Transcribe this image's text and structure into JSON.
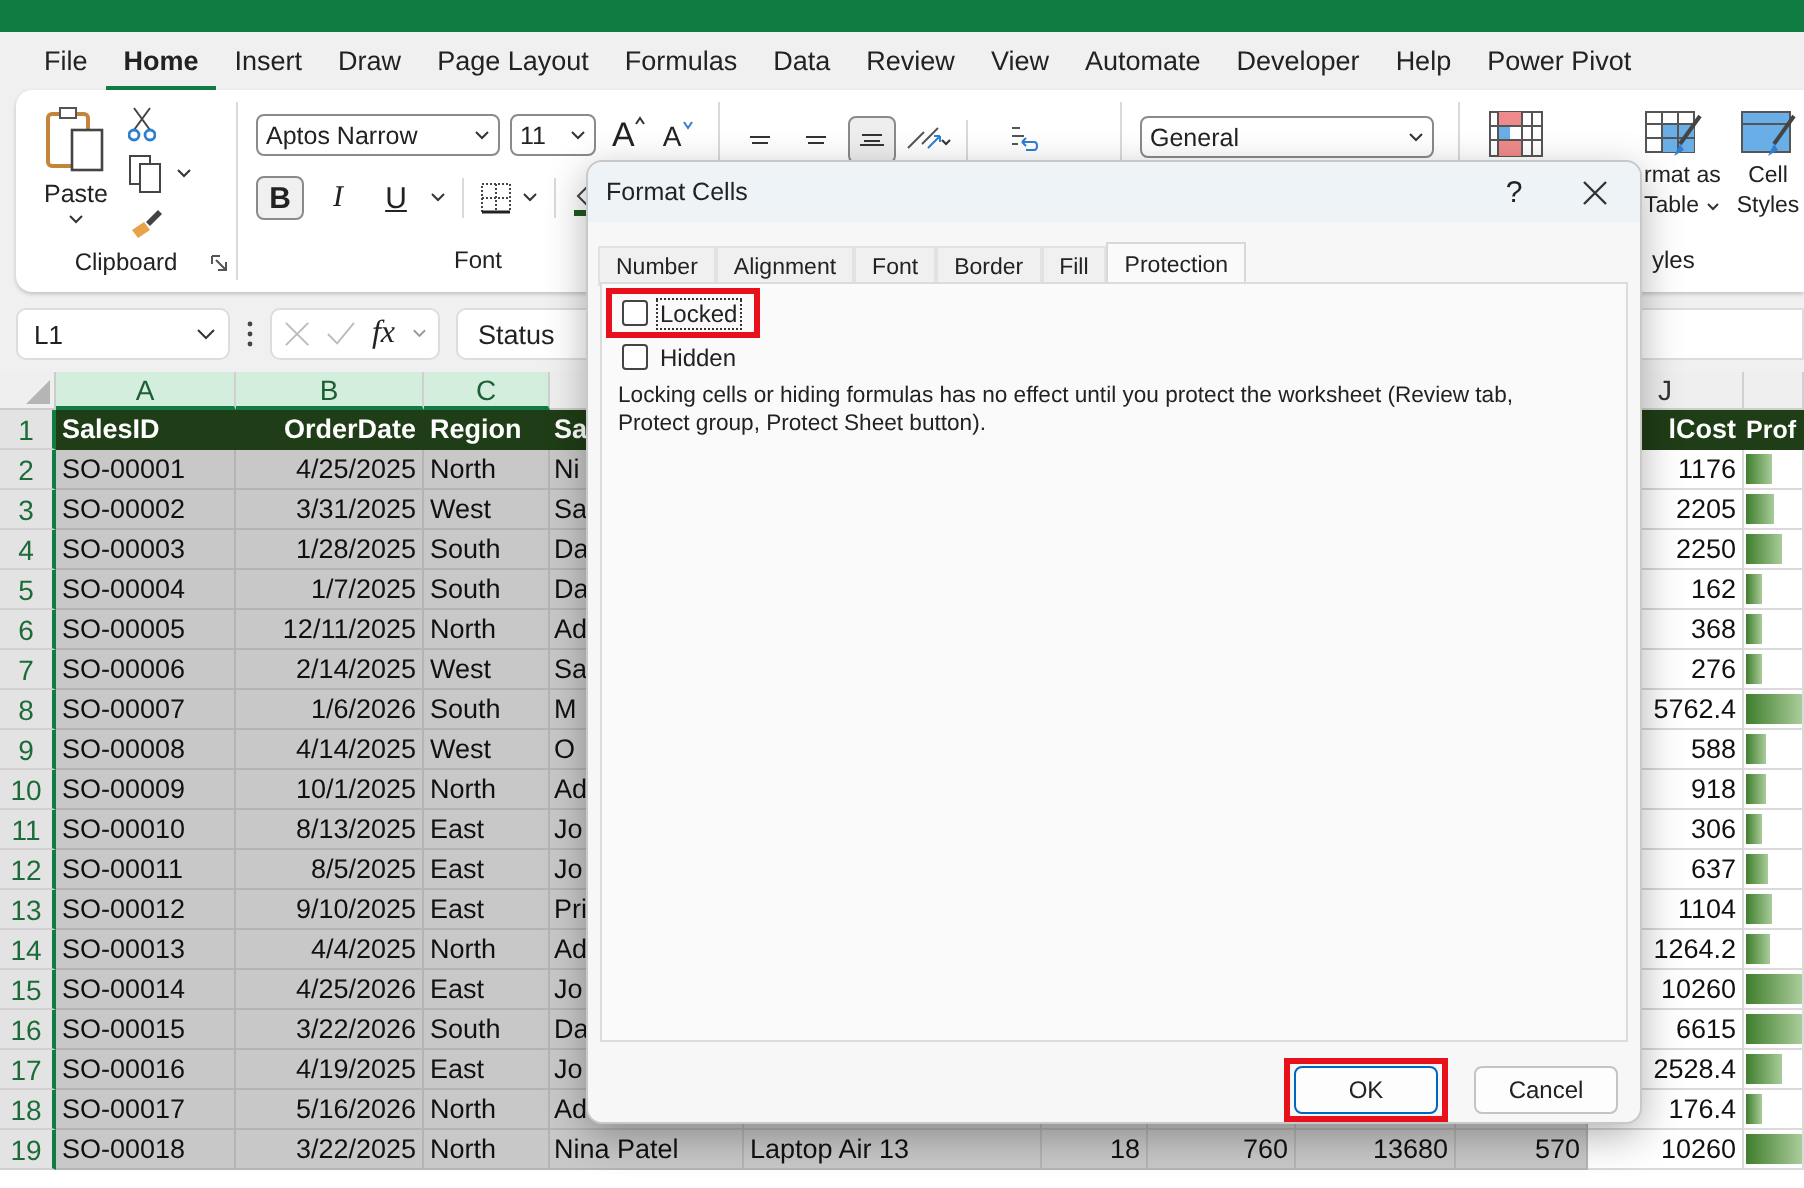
{
  "menu_tabs": [
    {
      "label": "File",
      "selected": false
    },
    {
      "label": "Home",
      "selected": true
    },
    {
      "label": "Insert",
      "selected": false
    },
    {
      "label": "Draw",
      "selected": false
    },
    {
      "label": "Page Layout",
      "selected": false
    },
    {
      "label": "Formulas",
      "selected": false
    },
    {
      "label": "Data",
      "selected": false
    },
    {
      "label": "Review",
      "selected": false
    },
    {
      "label": "View",
      "selected": false
    },
    {
      "label": "Automate",
      "selected": false
    },
    {
      "label": "Developer",
      "selected": false
    },
    {
      "label": "Help",
      "selected": false
    },
    {
      "label": "Power Pivot",
      "selected": false
    }
  ],
  "clipboard": {
    "paste": "Paste",
    "label": "Clipboard"
  },
  "font": {
    "name": "Aptos Narrow",
    "size": "11",
    "grow": "A",
    "shrink": "A",
    "bold": {
      "label": "B",
      "on": true
    },
    "italic": "I",
    "underline": "U",
    "label": "Font"
  },
  "alignment": [
    {
      "kind": "top",
      "selected": false
    },
    {
      "kind": "middle",
      "selected": false
    },
    {
      "kind": "bottom",
      "selected": true
    }
  ],
  "number": {
    "format": "General"
  },
  "styles": {
    "format_as_table": [
      "rmat as",
      "Table"
    ],
    "cell_styles": [
      "Cell",
      "Styles"
    ],
    "label": "yles"
  },
  "formula_bar": {
    "name_box": "L1",
    "fx": "fx",
    "content": "Status"
  },
  "column_headers": [
    {
      "letter": "A",
      "selected": true
    },
    {
      "letter": "B",
      "selected": true
    },
    {
      "letter": "C",
      "selected": true
    },
    {
      "letter": "J",
      "selected": false
    }
  ],
  "rows": [
    {
      "num": "1",
      "header": true,
      "cells": [
        "SalesID",
        "OrderDate",
        "Region",
        "Sa"
      ],
      "j": "lCost",
      "k": "Prof"
    },
    {
      "num": "2",
      "cells": [
        "SO-00001",
        "4/25/2025",
        "North",
        "Ni"
      ],
      "j": "1176",
      "level": 0.45
    },
    {
      "num": "3",
      "cells": [
        "SO-00002",
        "3/31/2025",
        "West",
        "Sa"
      ],
      "j": "2205",
      "level": 0.5
    },
    {
      "num": "4",
      "cells": [
        "SO-00003",
        "1/28/2025",
        "South",
        "Da"
      ],
      "j": "2250",
      "level": 0.65
    },
    {
      "num": "5",
      "cells": [
        "SO-00004",
        "1/7/2025",
        "South",
        "Da"
      ],
      "j": "162",
      "level": 0.27
    },
    {
      "num": "6",
      "cells": [
        "SO-00005",
        "12/11/2025",
        "North",
        "Ad"
      ],
      "j": "368",
      "level": 0.27
    },
    {
      "num": "7",
      "cells": [
        "SO-00006",
        "2/14/2025",
        "West",
        "Sa"
      ],
      "j": "276",
      "level": 0.27
    },
    {
      "num": "8",
      "cells": [
        "SO-00007",
        "1/6/2026",
        "South",
        "M"
      ],
      "j": "5762.4",
      "level": 1
    },
    {
      "num": "9",
      "cells": [
        "SO-00008",
        "4/14/2025",
        "West",
        "O"
      ],
      "j": "588",
      "level": 0.37
    },
    {
      "num": "10",
      "cells": [
        "SO-00009",
        "10/1/2025",
        "North",
        "Ad"
      ],
      "j": "918",
      "level": 0.37
    },
    {
      "num": "11",
      "cells": [
        "SO-00010",
        "8/13/2025",
        "East",
        "Jo"
      ],
      "j": "306",
      "level": 0.27
    },
    {
      "num": "12",
      "cells": [
        "SO-00011",
        "8/5/2025",
        "East",
        "Jo"
      ],
      "j": "637",
      "level": 0.4
    },
    {
      "num": "13",
      "cells": [
        "SO-00012",
        "9/10/2025",
        "East",
        "Pri"
      ],
      "j": "1104",
      "level": 0.47
    },
    {
      "num": "14",
      "cells": [
        "SO-00013",
        "4/4/2025",
        "North",
        "Ad"
      ],
      "j": "1264.2",
      "level": 0.43
    },
    {
      "num": "15",
      "cells": [
        "SO-00014",
        "4/25/2026",
        "East",
        "Jo"
      ],
      "j": "10260",
      "level": 1
    },
    {
      "num": "16",
      "cells": [
        "SO-00015",
        "3/22/2026",
        "South",
        "Da"
      ],
      "j": "6615",
      "level": 1
    },
    {
      "num": "17",
      "cells": [
        "SO-00016",
        "4/19/2025",
        "East",
        "Jo"
      ],
      "j": "2528.4",
      "level": 0.65
    },
    {
      "num": "18",
      "cells": [
        "SO-00017",
        "5/16/2026",
        "North",
        "Ad"
      ],
      "j": "176.4",
      "level": 0.3
    },
    {
      "num": "19",
      "cells": [
        "SO-00018",
        "3/22/2025",
        "North",
        "Nina Patel",
        "Laptop Air 13",
        "18",
        "760",
        "13680",
        "570"
      ],
      "j": "10260",
      "level": 1
    }
  ],
  "dialog": {
    "title": "Format Cells",
    "help": "?",
    "tabs": [
      {
        "label": "Number",
        "selected": false
      },
      {
        "label": "Alignment",
        "selected": false
      },
      {
        "label": "Font",
        "selected": false
      },
      {
        "label": "Border",
        "selected": false
      },
      {
        "label": "Fill",
        "selected": false
      },
      {
        "label": "Protection",
        "selected": true
      }
    ],
    "checkboxes": [
      {
        "label": "Locked",
        "checked": false,
        "focused": true,
        "highlighted": true
      },
      {
        "label": "Hidden",
        "checked": false,
        "focused": false,
        "highlighted": false
      }
    ],
    "note": "Locking cells or hiding formulas has no effect until you protect the worksheet (Review tab, Protect group, Protect Sheet button).",
    "buttons": [
      {
        "label": "OK",
        "highlighted": true
      },
      {
        "label": "Cancel",
        "highlighted": false
      }
    ]
  }
}
